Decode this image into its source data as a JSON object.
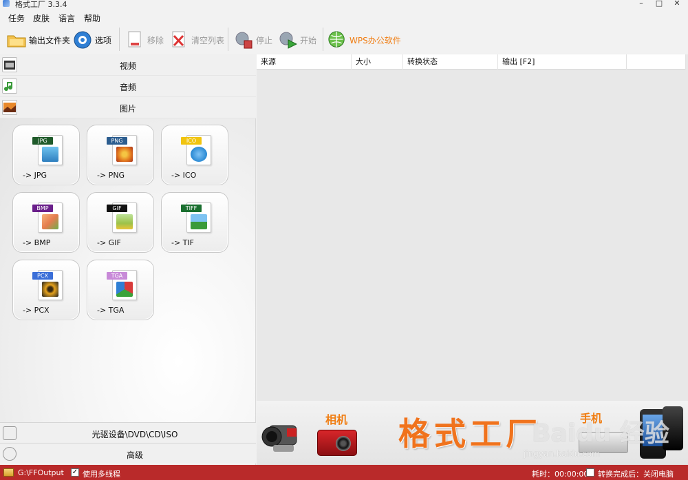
{
  "window": {
    "title": "格式工厂  3.3.4",
    "minimize": "–",
    "maximize": "□",
    "close": "✕"
  },
  "menu": [
    "任务",
    "皮肤",
    "语言",
    "帮助"
  ],
  "toolbar": {
    "output_folder": "输出文件夹",
    "options": "选项",
    "remove": "移除",
    "clear_list": "清空列表",
    "stop": "停止",
    "start": "开始",
    "wps": "WPS办公软件"
  },
  "categories": {
    "video": "视频",
    "audio": "音频",
    "image": "图片"
  },
  "formats": [
    {
      "label": "-> JPG",
      "tag": "JPG",
      "tag_color": "#1f5a2a",
      "pic_color": "#4a9fd8"
    },
    {
      "label": "-> PNG",
      "tag": "PNG",
      "tag_color": "#2c5d8f",
      "pic_color": "#e1751d"
    },
    {
      "label": "-> ICO",
      "tag": "ICO",
      "tag_color": "#f1c40f",
      "pic_color": "#2b8ad4"
    },
    {
      "label": "-> BMP",
      "tag": "BMP",
      "tag_color": "#6a1f8a",
      "pic_color": "#e57d4f"
    },
    {
      "label": "-> GIF",
      "tag": "GIF",
      "tag_color": "#111111",
      "pic_color": "#9cc24a"
    },
    {
      "label": "-> TIF",
      "tag": "TIFF",
      "tag_color": "#1a6f2f",
      "pic_color": "#3d8ed6"
    },
    {
      "label": "-> PCX",
      "tag": "PCX",
      "tag_color": "#3b6fd8",
      "pic_color": "#e6a21b"
    },
    {
      "label": "-> TGA",
      "tag": "TGA",
      "tag_color": "#c88ad8",
      "pic_color": "#3aa23a"
    }
  ],
  "bottom_rows": {
    "optical": "光驱设备\\DVD\\CD\\ISO",
    "advanced": "高级"
  },
  "table": {
    "columns": [
      "来源",
      "大小",
      "转换状态",
      "输出 [F2]",
      ""
    ]
  },
  "banner": {
    "brand": "格式工厂",
    "camera_label": "相机",
    "phone_label": "手机",
    "watermark": "Baidu 经验",
    "watermark_url": "jingyan.baidu.com"
  },
  "status": {
    "output_path": "G:\\FFOutput",
    "multithread_check": "✓",
    "multithread": "使用多线程",
    "elapsed": "耗时：00:00:00",
    "after_complete": "转换完成后：关闭电脑"
  }
}
